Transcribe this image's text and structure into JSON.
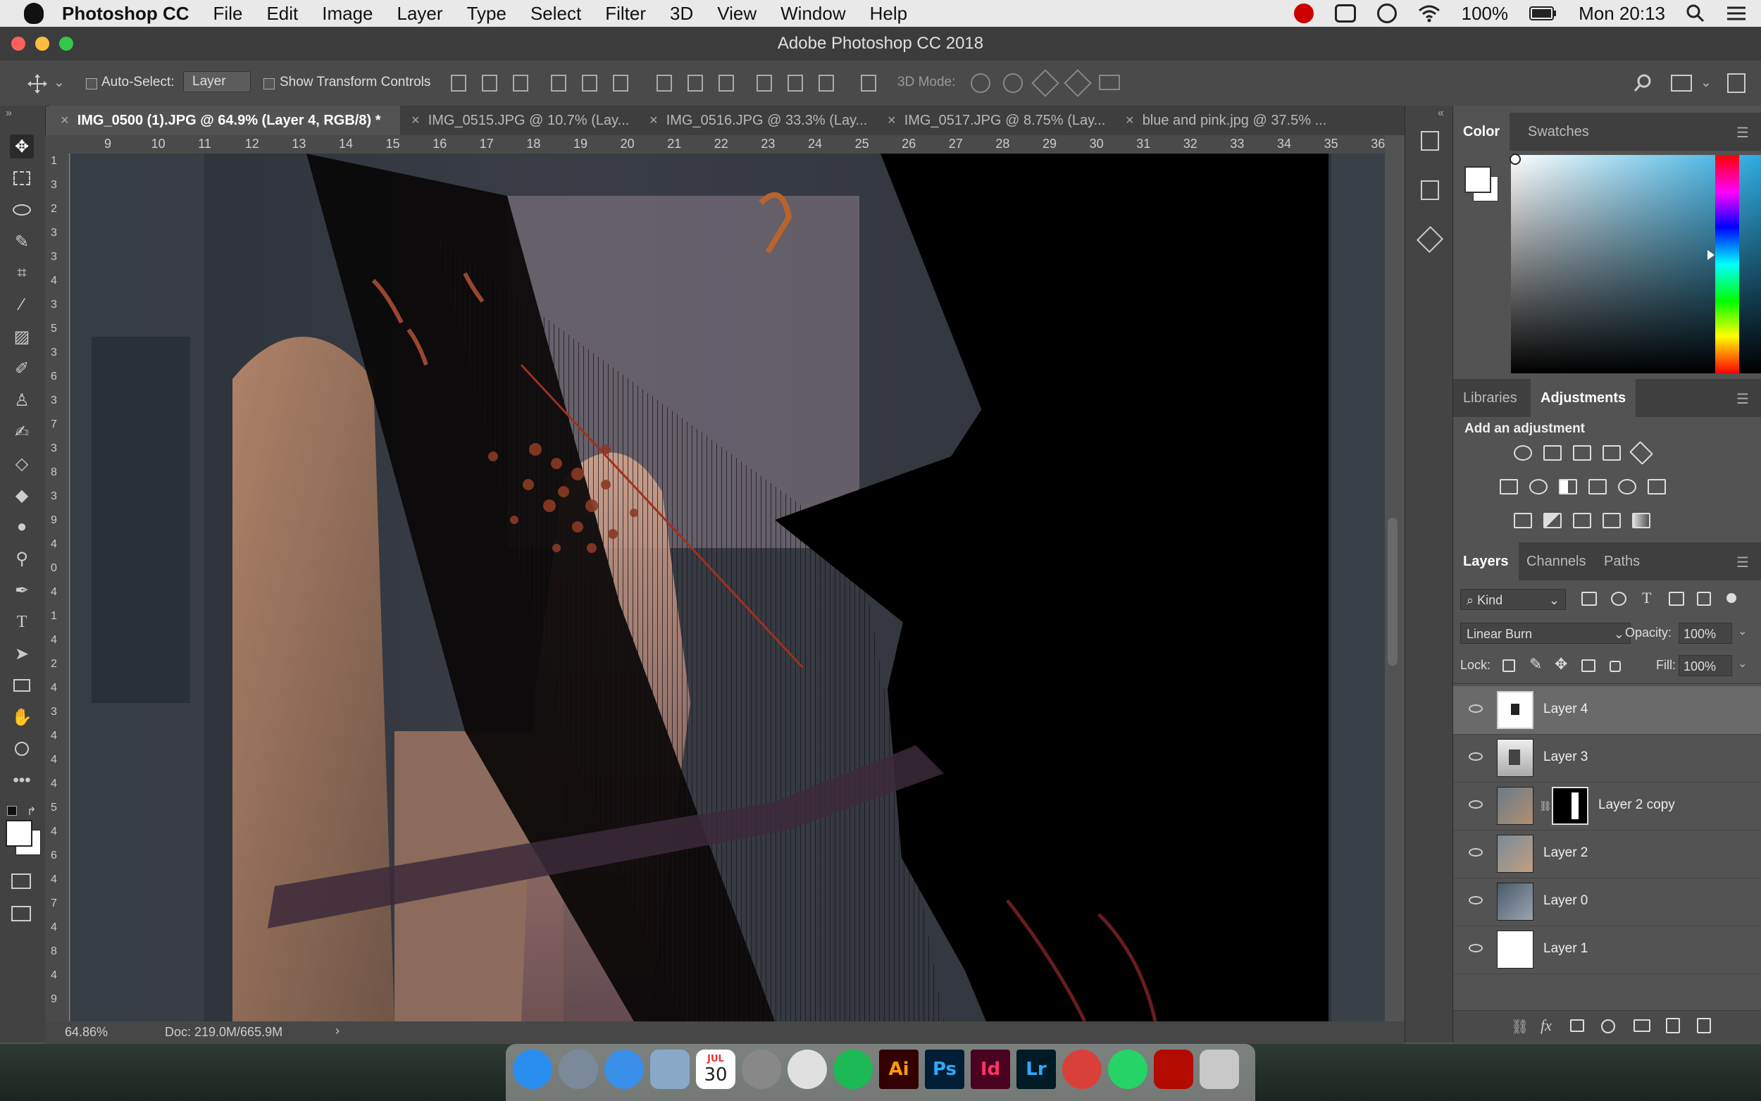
{
  "menubar": {
    "app": "Photoshop CC",
    "items": [
      "File",
      "Edit",
      "Image",
      "Layer",
      "Type",
      "Select",
      "Filter",
      "3D",
      "View",
      "Window",
      "Help"
    ],
    "battery": "100%",
    "clock": "Mon 20:13"
  },
  "window": {
    "title": "Adobe Photoshop CC 2018"
  },
  "options": {
    "auto_select": "Auto-Select:",
    "auto_select_value": "Layer",
    "show_transform": "Show Transform Controls",
    "mode3d": "3D Mode:"
  },
  "tabs": [
    "IMG_0500 (1).JPG @ 64.9% (Layer 4, RGB/8) *",
    "IMG_0515.JPG @ 10.7% (Lay...",
    "IMG_0516.JPG @ 33.3% (Lay...",
    "IMG_0517.JPG @ 8.75% (Lay...",
    "blue and pink.jpg @ 37.5% ..."
  ],
  "ruler": {
    "h": [
      "9",
      "10",
      "11",
      "12",
      "13",
      "14",
      "15",
      "16",
      "17",
      "18",
      "19",
      "20",
      "21",
      "22",
      "23",
      "24",
      "25",
      "26",
      "27",
      "28",
      "29",
      "30",
      "31",
      "32",
      "33",
      "34",
      "35",
      "36"
    ],
    "v": [
      "1",
      "3",
      "2",
      "3",
      "3",
      "4",
      "3",
      "5",
      "3",
      "6",
      "3",
      "7",
      "3",
      "8",
      "3",
      "9",
      "4",
      "0",
      "4",
      "1",
      "4",
      "2",
      "4",
      "3",
      "4",
      "4",
      "4",
      "5",
      "4",
      "6",
      "4",
      "7",
      "4",
      "8",
      "4",
      "9"
    ]
  },
  "status": {
    "zoom": "64.86%",
    "doc": "Doc: 219.0M/665.9M",
    "arrow": "›"
  },
  "color_panel": {
    "tabs": [
      "Color",
      "Swatches"
    ],
    "fg": "#ffffff",
    "bg": "#ffffff",
    "hue": "#29a9e0"
  },
  "adjust_panel": {
    "tabs": [
      "Libraries",
      "Adjustments"
    ],
    "heading": "Add an adjustment"
  },
  "layers_panel": {
    "tabs": [
      "Layers",
      "Channels",
      "Paths"
    ],
    "kind": "Kind",
    "blend": "Linear Burn",
    "opacity_label": "Opacity:",
    "opacity": "100%",
    "lock_label": "Lock:",
    "fill_label": "Fill:",
    "fill": "100%",
    "layers": [
      {
        "name": "Layer 4",
        "selected": true
      },
      {
        "name": "Layer 3",
        "selected": false
      },
      {
        "name": "Layer 2 copy",
        "selected": false,
        "mask": true
      },
      {
        "name": "Layer 2",
        "selected": false
      },
      {
        "name": "Layer 0",
        "selected": false
      },
      {
        "name": "Layer 1",
        "selected": false
      }
    ],
    "footer": [
      "link-icon",
      "fx",
      "mask-icon",
      "adjustment-icon",
      "folder-icon",
      "new-layer-icon",
      "trash-icon"
    ],
    "fx": "fx"
  },
  "dock": {
    "calendar_month": "JUL",
    "calendar_day": "30",
    "apps": [
      {
        "icon": "finder-icon",
        "label": "",
        "color": "#2a8ef0"
      },
      {
        "icon": "launchpad-icon",
        "label": "",
        "color": "#7a8a9a"
      },
      {
        "icon": "safari-icon",
        "label": "",
        "color": "#3a8fe8"
      },
      {
        "icon": "preview-icon",
        "label": "",
        "color": "#8aa9c8"
      },
      {
        "icon": "calendar-icon",
        "label": "",
        "color": "#ffffff"
      },
      {
        "icon": "system-preferences-icon",
        "label": "",
        "color": "#888888"
      },
      {
        "icon": "chrome-icon",
        "label": "",
        "color": "#e0e0e0"
      },
      {
        "icon": "spotify-icon",
        "label": "",
        "color": "#1db954"
      },
      {
        "icon": "illustrator-icon",
        "label": "Ai",
        "color": "#330000"
      },
      {
        "icon": "photoshop-icon",
        "label": "Ps",
        "color": "#001e36"
      },
      {
        "icon": "indesign-icon",
        "label": "Id",
        "color": "#49021f"
      },
      {
        "icon": "lightroom-icon",
        "label": "Lr",
        "color": "#001a26"
      },
      {
        "icon": "red-app-icon",
        "label": "",
        "color": "#d9403a"
      },
      {
        "icon": "whatsapp-icon",
        "label": "",
        "color": "#25d366"
      },
      {
        "icon": "acrobat-icon",
        "label": "",
        "color": "#b30b00"
      },
      {
        "icon": "trash-icon",
        "label": "",
        "color": "#c8c8c8"
      }
    ]
  }
}
